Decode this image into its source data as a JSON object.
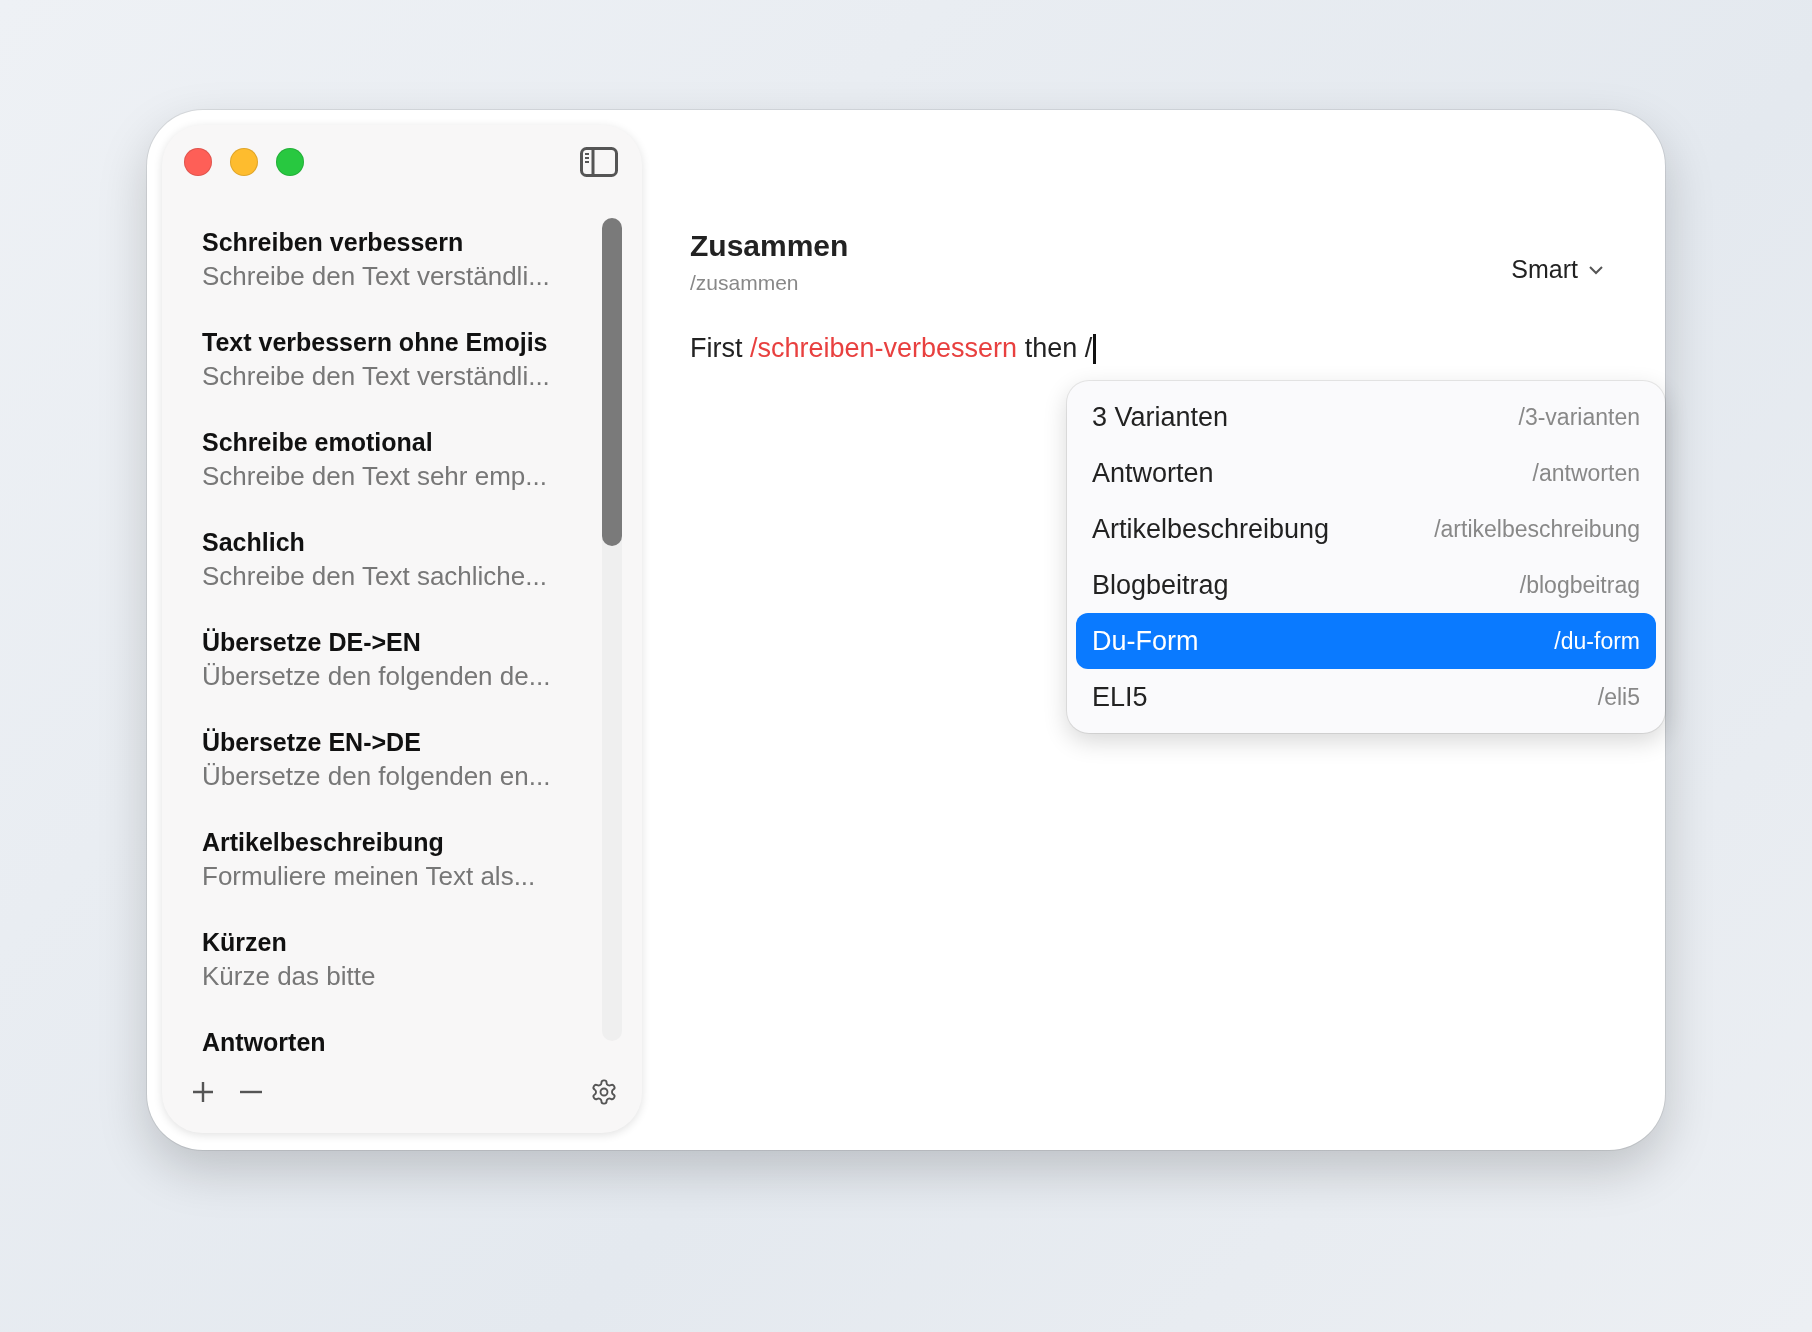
{
  "sidebar": {
    "items": [
      {
        "title": "Schreiben verbessern",
        "subtitle": "Schreibe den Text verständli..."
      },
      {
        "title": "Text verbessern ohne Emojis",
        "subtitle": "Schreibe den Text verständli..."
      },
      {
        "title": "Schreibe emotional",
        "subtitle": "Schreibe den Text sehr emp..."
      },
      {
        "title": "Sachlich",
        "subtitle": "Schreibe den Text sachliche..."
      },
      {
        "title": "Übersetze DE->EN",
        "subtitle": "Übersetze den folgenden de..."
      },
      {
        "title": "Übersetze EN->DE",
        "subtitle": "Übersetze den folgenden en..."
      },
      {
        "title": "Artikelbeschreibung",
        "subtitle": "Formuliere meinen Text als..."
      },
      {
        "title": "Kürzen",
        "subtitle": "Kürze das bitte"
      },
      {
        "title": "Antworten"
      }
    ]
  },
  "editor": {
    "title": "Zusammen",
    "slug": "/zusammen",
    "model": "Smart",
    "segments": [
      {
        "kind": "text",
        "text": "First "
      },
      {
        "kind": "command",
        "text": "/schreiben-verbessern"
      },
      {
        "kind": "text",
        "text": " then /"
      }
    ]
  },
  "suggestions": [
    {
      "label": "3 Varianten",
      "command": "/3-varianten",
      "selected": false
    },
    {
      "label": "Antworten",
      "command": "/antworten",
      "selected": false
    },
    {
      "label": "Artikelbeschreibung",
      "command": "/artikelbeschreibung",
      "selected": false
    },
    {
      "label": "Blogbeitrag",
      "command": "/blogbeitrag",
      "selected": false
    },
    {
      "label": "Du-Form",
      "command": "/du-form",
      "selected": true
    },
    {
      "label": "ELI5",
      "command": "/eli5",
      "selected": false
    }
  ]
}
